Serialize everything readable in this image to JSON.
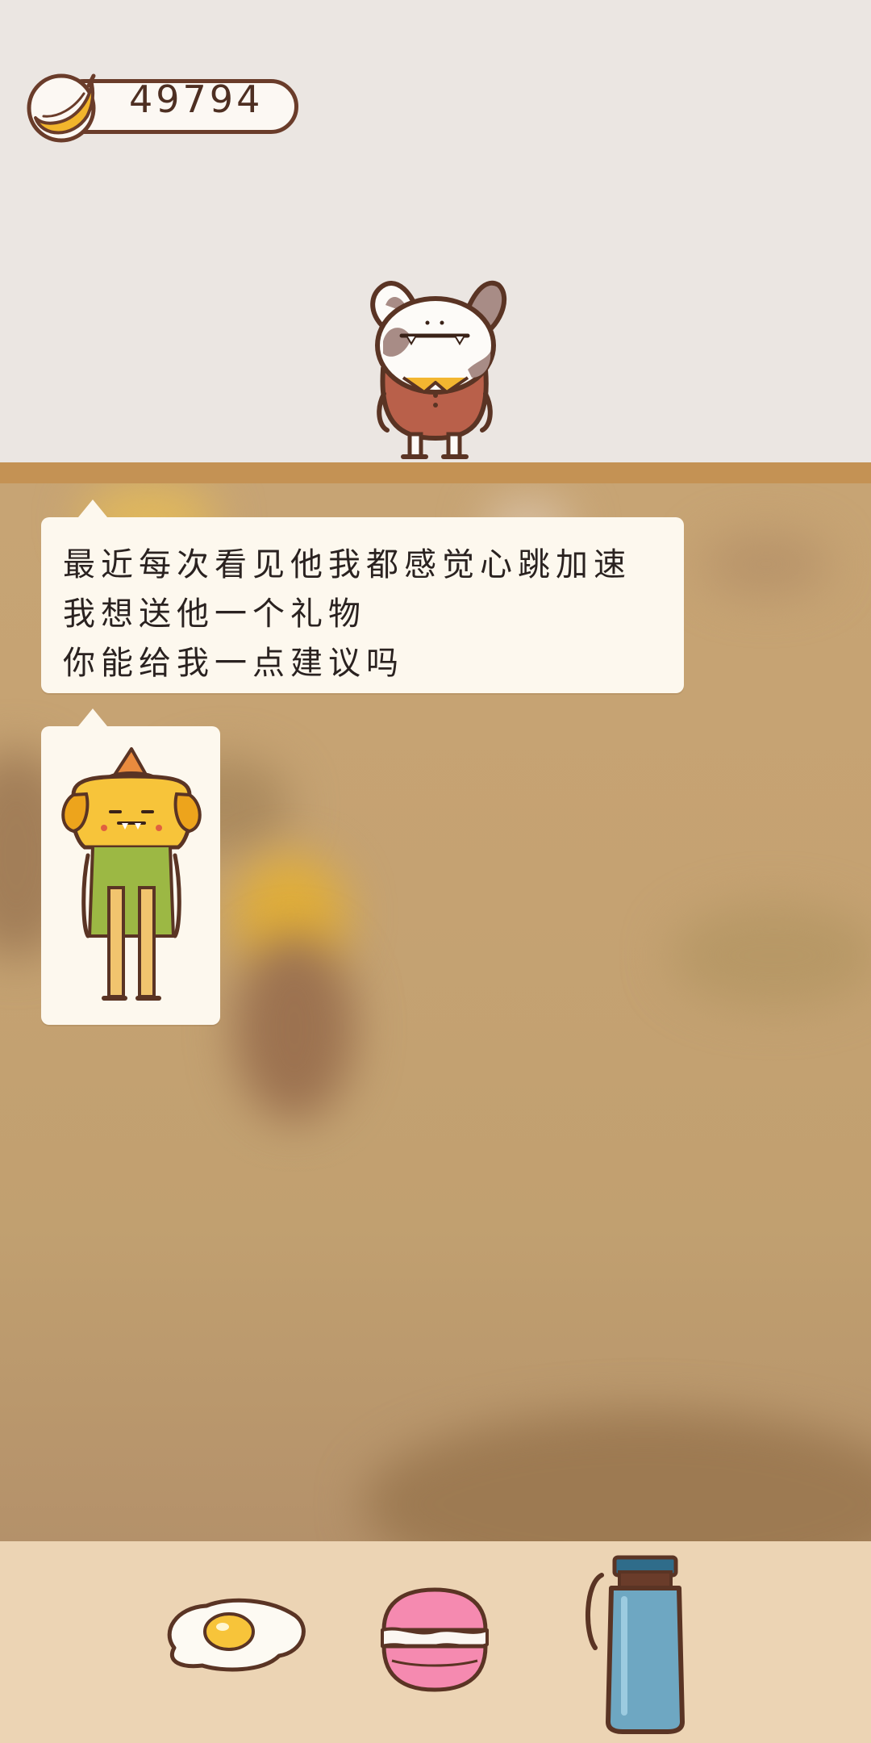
{
  "hud": {
    "coins": "49794",
    "coin_icon": "banana-icon"
  },
  "scene": {
    "top_character": "bunny-character",
    "shelf_color": "#c49254"
  },
  "dialog": {
    "lines": [
      "最近每次看见他我都感觉心跳加速",
      "我想送他一个礼物",
      "你能给我一点建议吗"
    ],
    "image_character": "yellow-dog-character"
  },
  "gifts": [
    {
      "name": "fried-egg-icon"
    },
    {
      "name": "macaron-icon"
    },
    {
      "name": "water-bottle-icon"
    }
  ],
  "colors": {
    "background": "#ebe6e2",
    "bubble": "#fdf8ee",
    "bottom_bar": "#ecd4b4",
    "outline": "#6a3c2a"
  }
}
